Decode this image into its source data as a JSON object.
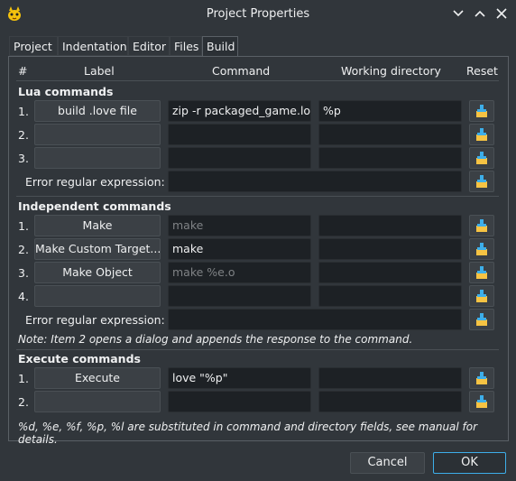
{
  "window": {
    "title": "Project Properties"
  },
  "tabs": [
    "Project",
    "Indentation",
    "Editor",
    "Files",
    "Build"
  ],
  "active_tab": "Build",
  "headers": {
    "num": "#",
    "label": "Label",
    "command": "Command",
    "workdir": "Working directory",
    "reset": "Reset"
  },
  "lua": {
    "title": "Lua commands",
    "rows": [
      {
        "num": "1.",
        "label": "build .love file",
        "command": "zip -r packaged_game.love",
        "workdir": "%p"
      },
      {
        "num": "2.",
        "label": "",
        "command": "",
        "workdir": ""
      },
      {
        "num": "3.",
        "label": "",
        "command": "",
        "workdir": ""
      }
    ],
    "error_label": "Error regular expression:"
  },
  "independent": {
    "title": "Independent commands",
    "rows": [
      {
        "num": "1.",
        "label": "Make",
        "command": "make",
        "command_is_placeholder": true,
        "workdir": ""
      },
      {
        "num": "2.",
        "label": "Make Custom Target...",
        "command": "make",
        "command_is_placeholder": false,
        "workdir": ""
      },
      {
        "num": "3.",
        "label": "Make Object",
        "command": "make %e.o",
        "command_is_placeholder": true,
        "workdir": ""
      },
      {
        "num": "4.",
        "label": "",
        "command": "",
        "command_is_placeholder": false,
        "workdir": ""
      }
    ],
    "error_label": "Error regular expression:",
    "note": "Note: Item 2 opens a dialog and appends the response to the command."
  },
  "execute": {
    "title": "Execute commands",
    "rows": [
      {
        "num": "1.",
        "label": "Execute",
        "command": "love \"%p\"",
        "workdir": ""
      },
      {
        "num": "2.",
        "label": "",
        "command": "",
        "workdir": ""
      }
    ]
  },
  "footer_note": "%d, %e, %f, %p, %l are substituted in command and directory fields, see manual for details.",
  "buttons": {
    "cancel": "Cancel",
    "ok": "OK"
  },
  "icons": {
    "reset": "clear-icon",
    "app": "geany-icon"
  },
  "colors": {
    "accent": "#3daee9",
    "bg": "#31363b",
    "field": "#1d2125"
  }
}
